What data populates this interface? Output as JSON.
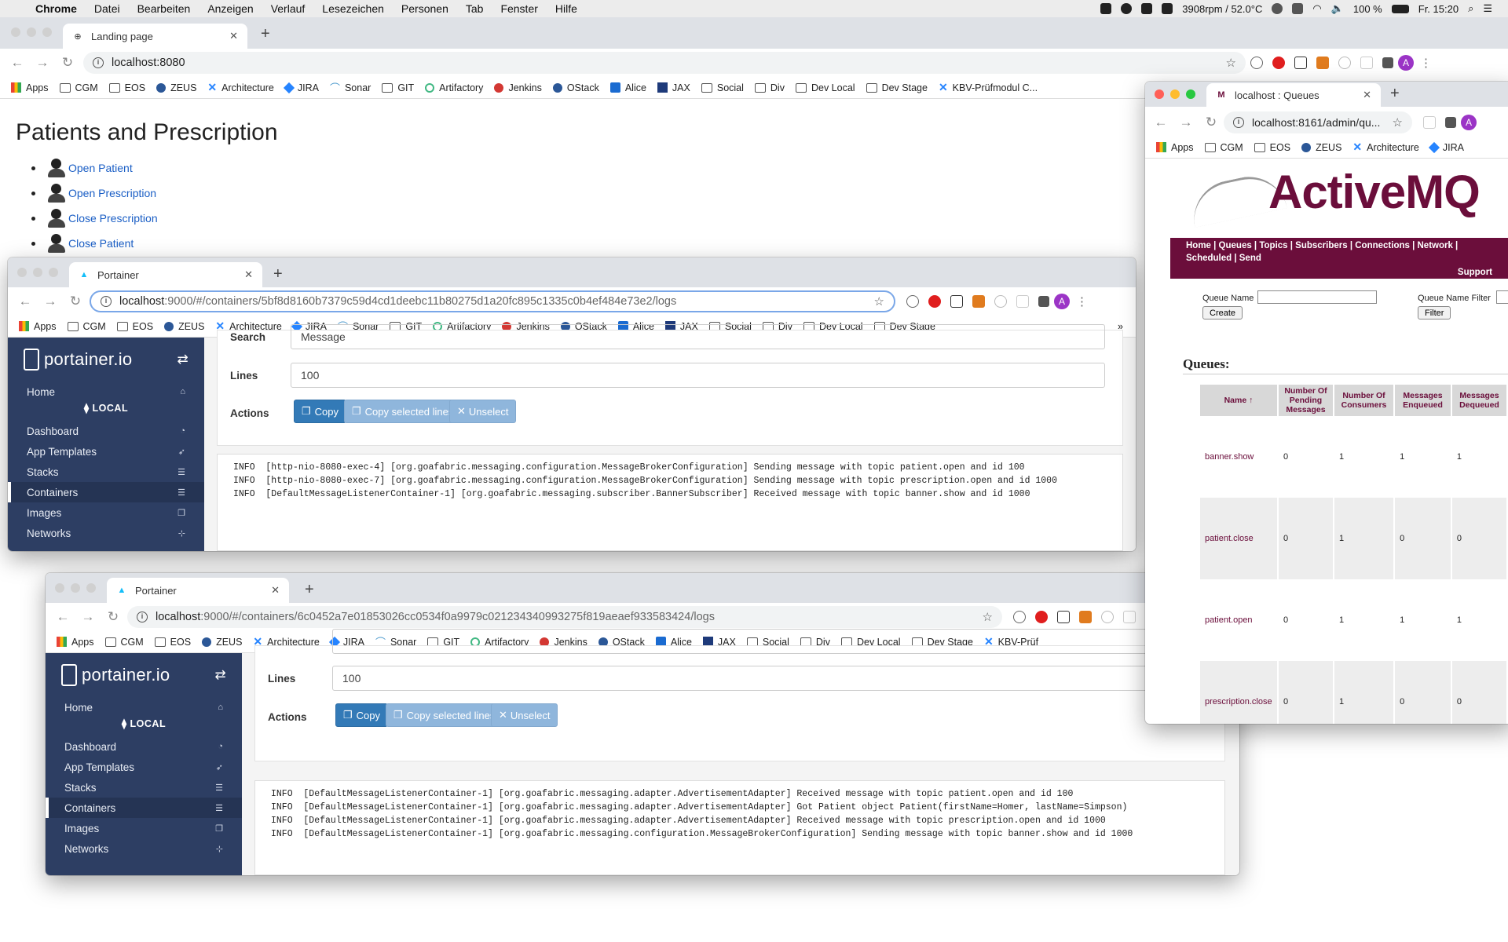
{
  "menubar": {
    "items": [
      "Chrome",
      "Datei",
      "Bearbeiten",
      "Anzeigen",
      "Verlauf",
      "Lesezeichen",
      "Personen",
      "Tab",
      "Fenster",
      "Hilfe"
    ],
    "status_fan": "3908rpm / 52.0°C",
    "battery": "100 %",
    "clock": "Fr. 15:20"
  },
  "bookmarks": [
    "Apps",
    "CGM",
    "EOS",
    "ZEUS",
    "Architecture",
    "JIRA",
    "Sonar",
    "GIT",
    "Artifactory",
    "Jenkins",
    "OStack",
    "Alice",
    "JAX",
    "Social",
    "Div",
    "Dev Local",
    "Dev Stage",
    "KBV-Prüfmodul C..."
  ],
  "bookmarks_short_amq": [
    "Apps",
    "CGM",
    "EOS",
    "ZEUS",
    "Architecture",
    "JIRA"
  ],
  "bookmarks_p2_last": "KBV-Prüf",
  "landing": {
    "tab_title": "Landing page",
    "url": "localhost:8080",
    "heading": "Patients and Prescription",
    "links": [
      "Open Patient",
      "Open Prescription",
      "Close Prescription",
      "Close Patient"
    ]
  },
  "portainer1": {
    "tab_title": "Portainer",
    "url_host": "localhost",
    "url_rest": ":9000/#/containers/5bf8d8160b7379c59d4cd1deebc11b80275d1a20fc895c1335c0b4ef484e73e2/logs",
    "search_label": "Search",
    "search_value": "Message",
    "lines_label": "Lines",
    "lines_value": "100",
    "actions_label": "Actions",
    "logs": [
      "INFO  [http-nio-8080-exec-4] [org.goafabric.messaging.configuration.MessageBrokerConfiguration] Sending message with topic patient.open and id 100",
      "INFO  [http-nio-8080-exec-7] [org.goafabric.messaging.configuration.MessageBrokerConfiguration] Sending message with topic prescription.open and id 1000",
      "INFO  [DefaultMessageListenerContainer-1] [org.goafabric.messaging.subscriber.BannerSubscriber] Received message with topic banner.show and id 1000"
    ]
  },
  "portainer2": {
    "tab_title": "Portainer",
    "url_host": "localhost",
    "url_rest": ":9000/#/containers/6c0452a7e01853026cc0534f0a9979c021234340993275f819aeaef933583424/logs",
    "lines_label": "Lines",
    "lines_value": "100",
    "actions_label": "Actions",
    "logs": [
      "INFO  [DefaultMessageListenerContainer-1] [org.goafabric.messaging.adapter.AdvertisementAdapter] Received message with topic patient.open and id 100",
      "INFO  [DefaultMessageListenerContainer-1] [org.goafabric.messaging.adapter.AdvertisementAdapter] Got Patient object Patient(firstName=Homer, lastName=Simpson)",
      "INFO  [DefaultMessageListenerContainer-1] [org.goafabric.messaging.adapter.AdvertisementAdapter] Received message with topic prescription.open and id 1000",
      "INFO  [DefaultMessageListenerContainer-1] [org.goafabric.messaging.configuration.MessageBrokerConfiguration] Sending message with topic banner.show and id 1000"
    ]
  },
  "portainer_sidebar": {
    "logo": "portainer.io",
    "home": "Home",
    "local": "LOCAL",
    "items": [
      "Dashboard",
      "App Templates",
      "Stacks",
      "Containers",
      "Images",
      "Networks"
    ],
    "active": "Containers"
  },
  "buttons": {
    "copy": "Copy",
    "copy_selected": "Copy selected lines",
    "unselect": "Unselect"
  },
  "activemq": {
    "tab_title": "localhost : Queues",
    "url": "localhost:8161/admin/qu...",
    "logo": "ActiveMQ",
    "nav_line1": "Home | Queues | Topics | Subscribers | Connections | Network |",
    "nav_line2": "Scheduled | Send",
    "support": "Support",
    "queue_name_label": "Queue Name",
    "create_label": "Create",
    "filter_label_text": "Queue Name Filter",
    "filter_button": "Filter",
    "queues_heading": "Queues:",
    "columns": [
      "Name ↑",
      "Number Of Pending Messages",
      "Number Of Consumers",
      "Messages Enqueued",
      "Messages Dequeued"
    ],
    "rows": [
      {
        "name": "banner.show",
        "pending": "0",
        "consumers": "1",
        "enqueued": "1",
        "dequeued": "1"
      },
      {
        "name": "patient.close",
        "pending": "0",
        "consumers": "1",
        "enqueued": "0",
        "dequeued": "0"
      },
      {
        "name": "patient.open",
        "pending": "0",
        "consumers": "1",
        "enqueued": "1",
        "dequeued": "1"
      },
      {
        "name": "prescription.close",
        "pending": "0",
        "consumers": "1",
        "enqueued": "0",
        "dequeued": "0"
      }
    ]
  }
}
